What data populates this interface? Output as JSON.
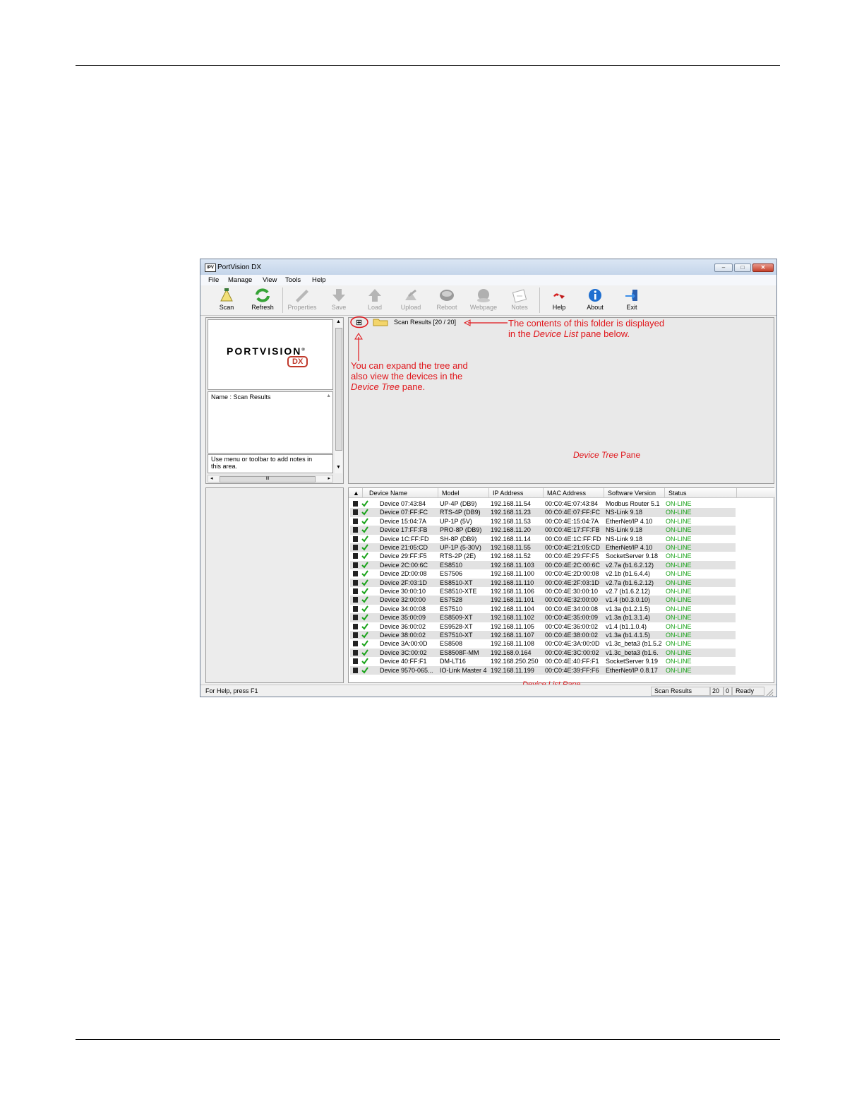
{
  "window": {
    "icon_text": "IPV",
    "title": "PortVision DX",
    "minimize": "–",
    "maximize": "□",
    "close": "✕"
  },
  "menu": [
    "File",
    "Manage",
    "View",
    "Tools",
    "Help"
  ],
  "toolbar": [
    {
      "label": "Scan",
      "icon": "scan-icon",
      "enabled": true
    },
    {
      "label": "Refresh",
      "icon": "refresh-icon",
      "enabled": true
    },
    {
      "label": "Properties",
      "icon": "properties-icon",
      "enabled": false
    },
    {
      "label": "Save",
      "icon": "save-icon",
      "enabled": false
    },
    {
      "label": "Load",
      "icon": "load-icon",
      "enabled": false
    },
    {
      "label": "Upload",
      "icon": "upload-icon",
      "enabled": false
    },
    {
      "label": "Reboot",
      "icon": "reboot-icon",
      "enabled": false
    },
    {
      "label": "Webpage",
      "icon": "webpage-icon",
      "enabled": false
    },
    {
      "label": "Notes",
      "icon": "notes-icon",
      "enabled": false
    },
    {
      "label": "Help",
      "icon": "help-icon",
      "enabled": true
    },
    {
      "label": "About",
      "icon": "about-icon",
      "enabled": true
    },
    {
      "label": "Exit",
      "icon": "exit-icon",
      "enabled": true
    }
  ],
  "logo": {
    "brand": "PORTVISION",
    "suffix": "DX",
    "tm": "®"
  },
  "info": {
    "name_text": "Name : Scan Results",
    "notes_text": "Use menu or toolbar to add notes in this area.",
    "hscroll_mark": "III"
  },
  "tree": {
    "expander": "⊞",
    "folder_label": "Scan Results [20 / 20]",
    "pane_label_italic": "Device Tree",
    "pane_label_rest": " Pane"
  },
  "annotations": {
    "folder_line1": "The contents of this folder is displayed",
    "folder_line2_pre": "in the ",
    "folder_line2_em": "Device List",
    "folder_line2_post": " pane below.",
    "expand_line1": "You can expand the tree and",
    "expand_line2": "also view the devices in the",
    "expand_line3_em": "Device Tree",
    "expand_line3_post": " pane."
  },
  "list": {
    "sort_arrow": "▲",
    "columns": [
      "Device Name",
      "Model",
      "IP Address",
      "MAC Address",
      "Software Version",
      "Status"
    ],
    "rows": [
      [
        "Device 07:43:84",
        "UP-4P (DB9)",
        "192.168.11.54",
        "00:C0:4E:07:43:84",
        "Modbus Router 5.1",
        "ON-LINE"
      ],
      [
        "Device 07:FF:FC",
        "RTS-4P (DB9)",
        "192.168.11.23",
        "00:C0:4E:07:FF:FC",
        "NS-Link 9.18",
        "ON-LINE"
      ],
      [
        "Device 15:04:7A",
        "UP-1P (5V)",
        "192.168.11.53",
        "00:C0:4E:15:04:7A",
        "EtherNet/IP 4.10",
        "ON-LINE"
      ],
      [
        "Device 17:FF:FB",
        "PRO-8P (DB9)",
        "192.168.11.20",
        "00:C0:4E:17:FF:FB",
        "NS-Link 9.18",
        "ON-LINE"
      ],
      [
        "Device 1C:FF:FD",
        "SH-8P (DB9)",
        "192.168.11.14",
        "00:C0:4E:1C:FF:FD",
        "NS-Link 9.18",
        "ON-LINE"
      ],
      [
        "Device 21:05:CD",
        "UP-1P (5-30V)",
        "192.168.11.55",
        "00:C0:4E:21:05:CD",
        "EtherNet/IP 4.10",
        "ON-LINE"
      ],
      [
        "Device 29:FF:F5",
        "RTS-2P (2E)",
        "192.168.11.52",
        "00:C0:4E:29:FF:F5",
        "SocketServer 9.18",
        "ON-LINE"
      ],
      [
        "Device 2C:00:6C",
        "ES8510",
        "192.168.11.103",
        "00:C0:4E:2C:00:6C",
        "v2.7a  (b1.6.2.12)",
        "ON-LINE"
      ],
      [
        "Device 2D:00:08",
        "ES7506",
        "192.168.11.100",
        "00:C0:4E:2D:00:08",
        "v2.1b  (b1.6.4.4)",
        "ON-LINE"
      ],
      [
        "Device 2F:03:1D",
        "ES8510-XT",
        "192.168.11.110",
        "00:C0:4E:2F:03:1D",
        "v2.7a  (b1.6.2.12)",
        "ON-LINE"
      ],
      [
        "Device 30:00:10",
        "ES8510-XTE",
        "192.168.11.106",
        "00:C0:4E:30:00:10",
        "v2.7  (b1.6.2.12)",
        "ON-LINE"
      ],
      [
        "Device 32:00:00",
        "ES7528",
        "192.168.11.101",
        "00:C0:4E:32:00:00",
        "v1.4  (b0.3.0.10)",
        "ON-LINE"
      ],
      [
        "Device 34:00:08",
        "ES7510",
        "192.168.11.104",
        "00:C0:4E:34:00:08",
        "v1.3a  (b1.2.1.5)",
        "ON-LINE"
      ],
      [
        "Device 35:00:09",
        "ES8509-XT",
        "192.168.11.102",
        "00:C0:4E:35:00:09",
        "v1.3a  (b1.3.1.4)",
        "ON-LINE"
      ],
      [
        "Device 36:00:02",
        "ES9528-XT",
        "192.168.11.105",
        "00:C0:4E:36:00:02",
        "v1.4  (b1.1.0.4)",
        "ON-LINE"
      ],
      [
        "Device 38:00:02",
        "ES7510-XT",
        "192.168.11.107",
        "00:C0:4E:38:00:02",
        "v1.3a  (b1.4.1.5)",
        "ON-LINE"
      ],
      [
        "Device 3A:00:0D",
        "ES8508",
        "192.168.11.108",
        "00:C0:4E:3A:00:0D",
        "v1.3c_beta3  (b1.5.2",
        "ON-LINE"
      ],
      [
        "Device 3C:00:02",
        "ES8508F-MM",
        "192.168.0.164",
        "00:C0:4E:3C:00:02",
        "v1.3c_beta3  (b1.6.",
        "ON-LINE"
      ],
      [
        "Device 40:FF:F1",
        "DM-LT16",
        "192.168.250.250",
        "00:C0:4E:40:FF:F1",
        "SocketServer 9.19",
        "ON-LINE"
      ],
      [
        "Device 9570-065...",
        "IO-Link Master 4",
        "192.168.11.199",
        "00:C0:4E:39:FF:F6",
        "EtherNet/IP 0.8.17",
        "ON-LINE"
      ]
    ],
    "pane_label": "Device List Pane"
  },
  "statusbar": {
    "help": "For Help, press F1",
    "folder": "Scan Results",
    "count": "20",
    "zero": "0",
    "state": "Ready"
  },
  "colors": {
    "annotation": "#e0151a",
    "online": "#1aa31a"
  }
}
